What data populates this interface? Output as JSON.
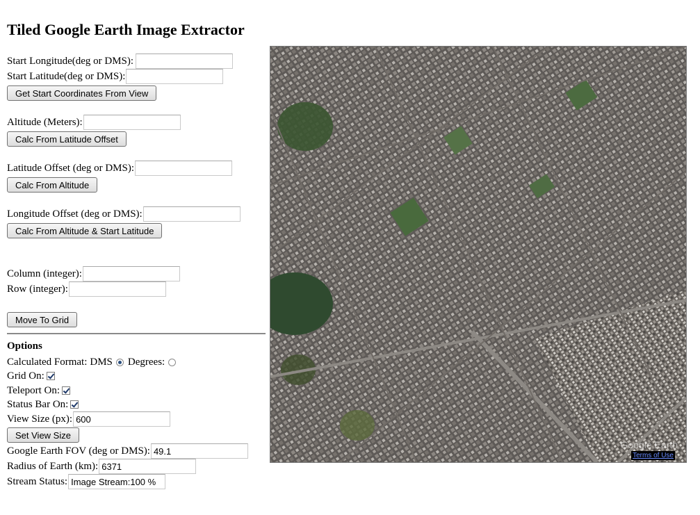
{
  "title": "Tiled Google Earth Image Extractor",
  "fields": {
    "start_longitude": {
      "label": "Start Longitude(deg or DMS):",
      "value": ""
    },
    "start_latitude": {
      "label": "Start Latitude(deg or DMS):",
      "value": ""
    },
    "altitude": {
      "label": "Altitude (Meters):",
      "value": ""
    },
    "latitude_offset": {
      "label": "Latitude Offset (deg or DMS):",
      "value": ""
    },
    "longitude_offset": {
      "label": "Longitude Offset (deg or DMS):",
      "value": ""
    },
    "column": {
      "label": "Column (integer):",
      "value": ""
    },
    "row": {
      "label": "Row (integer):",
      "value": ""
    }
  },
  "buttons": {
    "get_start": "Get Start Coordinates From View",
    "calc_from_lat_offset": "Calc From Latitude Offset",
    "calc_from_altitude": "Calc From Altitude",
    "calc_from_alt_start_lat": "Calc From Altitude & Start Latitude",
    "move_to_grid": "Move To Grid",
    "set_view_size": "Set View Size"
  },
  "options": {
    "heading": "Options",
    "calc_format_label": "Calculated Format:",
    "dms_label": "DMS",
    "degrees_label": "Degrees:",
    "dms_selected": true,
    "grid_on_label": "Grid On:",
    "grid_on": true,
    "teleport_on_label": "Teleport On:",
    "teleport_on": true,
    "status_bar_on_label": "Status Bar On:",
    "status_bar_on": true,
    "view_size_label": "View Size (px):",
    "view_size_value": "600",
    "fov_label": "Google Earth FOV (deg or DMS):",
    "fov_value": "49.1",
    "radius_label": "Radius of Earth (km):",
    "radius_value": "6371",
    "stream_status_label": "Stream Status:",
    "stream_status_value": "Image Stream:100 %"
  },
  "map": {
    "logo_text": "Google Earth",
    "terms_link": "Terms of Use"
  }
}
